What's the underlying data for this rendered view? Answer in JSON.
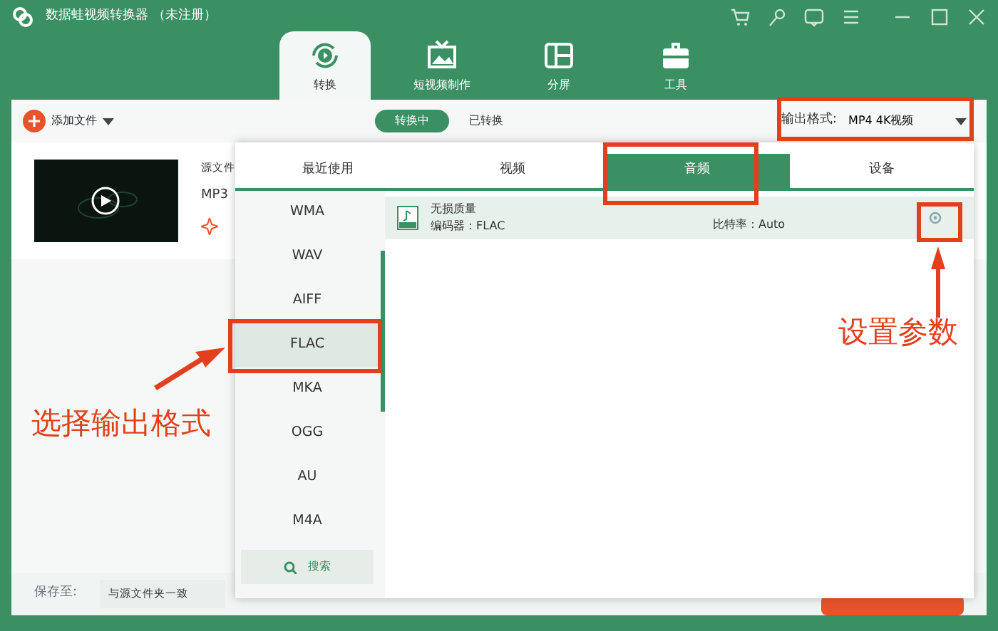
{
  "window": {
    "title": "数据蛙视频转换器 （未注册）"
  },
  "nav_tabs": [
    {
      "label": "转换",
      "selected": true
    },
    {
      "label": "短视频制作",
      "selected": false
    },
    {
      "label": "分屏",
      "selected": false
    },
    {
      "label": "工具",
      "selected": false
    }
  ],
  "toolbar": {
    "add_file": "添加文件",
    "segments": [
      {
        "label": "转换中",
        "selected": true
      },
      {
        "label": "已转换",
        "selected": false
      }
    ],
    "output_format_label": "输出格式:",
    "output_format_value": "MP4 4K视频"
  },
  "file_item": {
    "source_label": "源文件",
    "format": "MP3"
  },
  "footer": {
    "save_label": "保存至:",
    "save_value": "与源文件夹一致"
  },
  "format_popup": {
    "tabs": [
      {
        "label": "最近使用",
        "selected": false
      },
      {
        "label": "视频",
        "selected": false
      },
      {
        "label": "音频",
        "selected": true
      },
      {
        "label": "设备",
        "selected": false
      }
    ],
    "formats": [
      {
        "label": "WMA",
        "selected": false
      },
      {
        "label": "WAV",
        "selected": false
      },
      {
        "label": "AIFF",
        "selected": false
      },
      {
        "label": "FLAC",
        "selected": true
      },
      {
        "label": "MKA",
        "selected": false
      },
      {
        "label": "OGG",
        "selected": false
      },
      {
        "label": "AU",
        "selected": false
      },
      {
        "label": "M4A",
        "selected": false
      }
    ],
    "search": "搜索",
    "presets": [
      {
        "name": "无损质量",
        "encoder": "编码器：FLAC",
        "bitrate": "比特率：Auto"
      }
    ]
  },
  "annotations": [
    {
      "text": "设置参数"
    },
    {
      "text": "选择输出格式"
    }
  ]
}
